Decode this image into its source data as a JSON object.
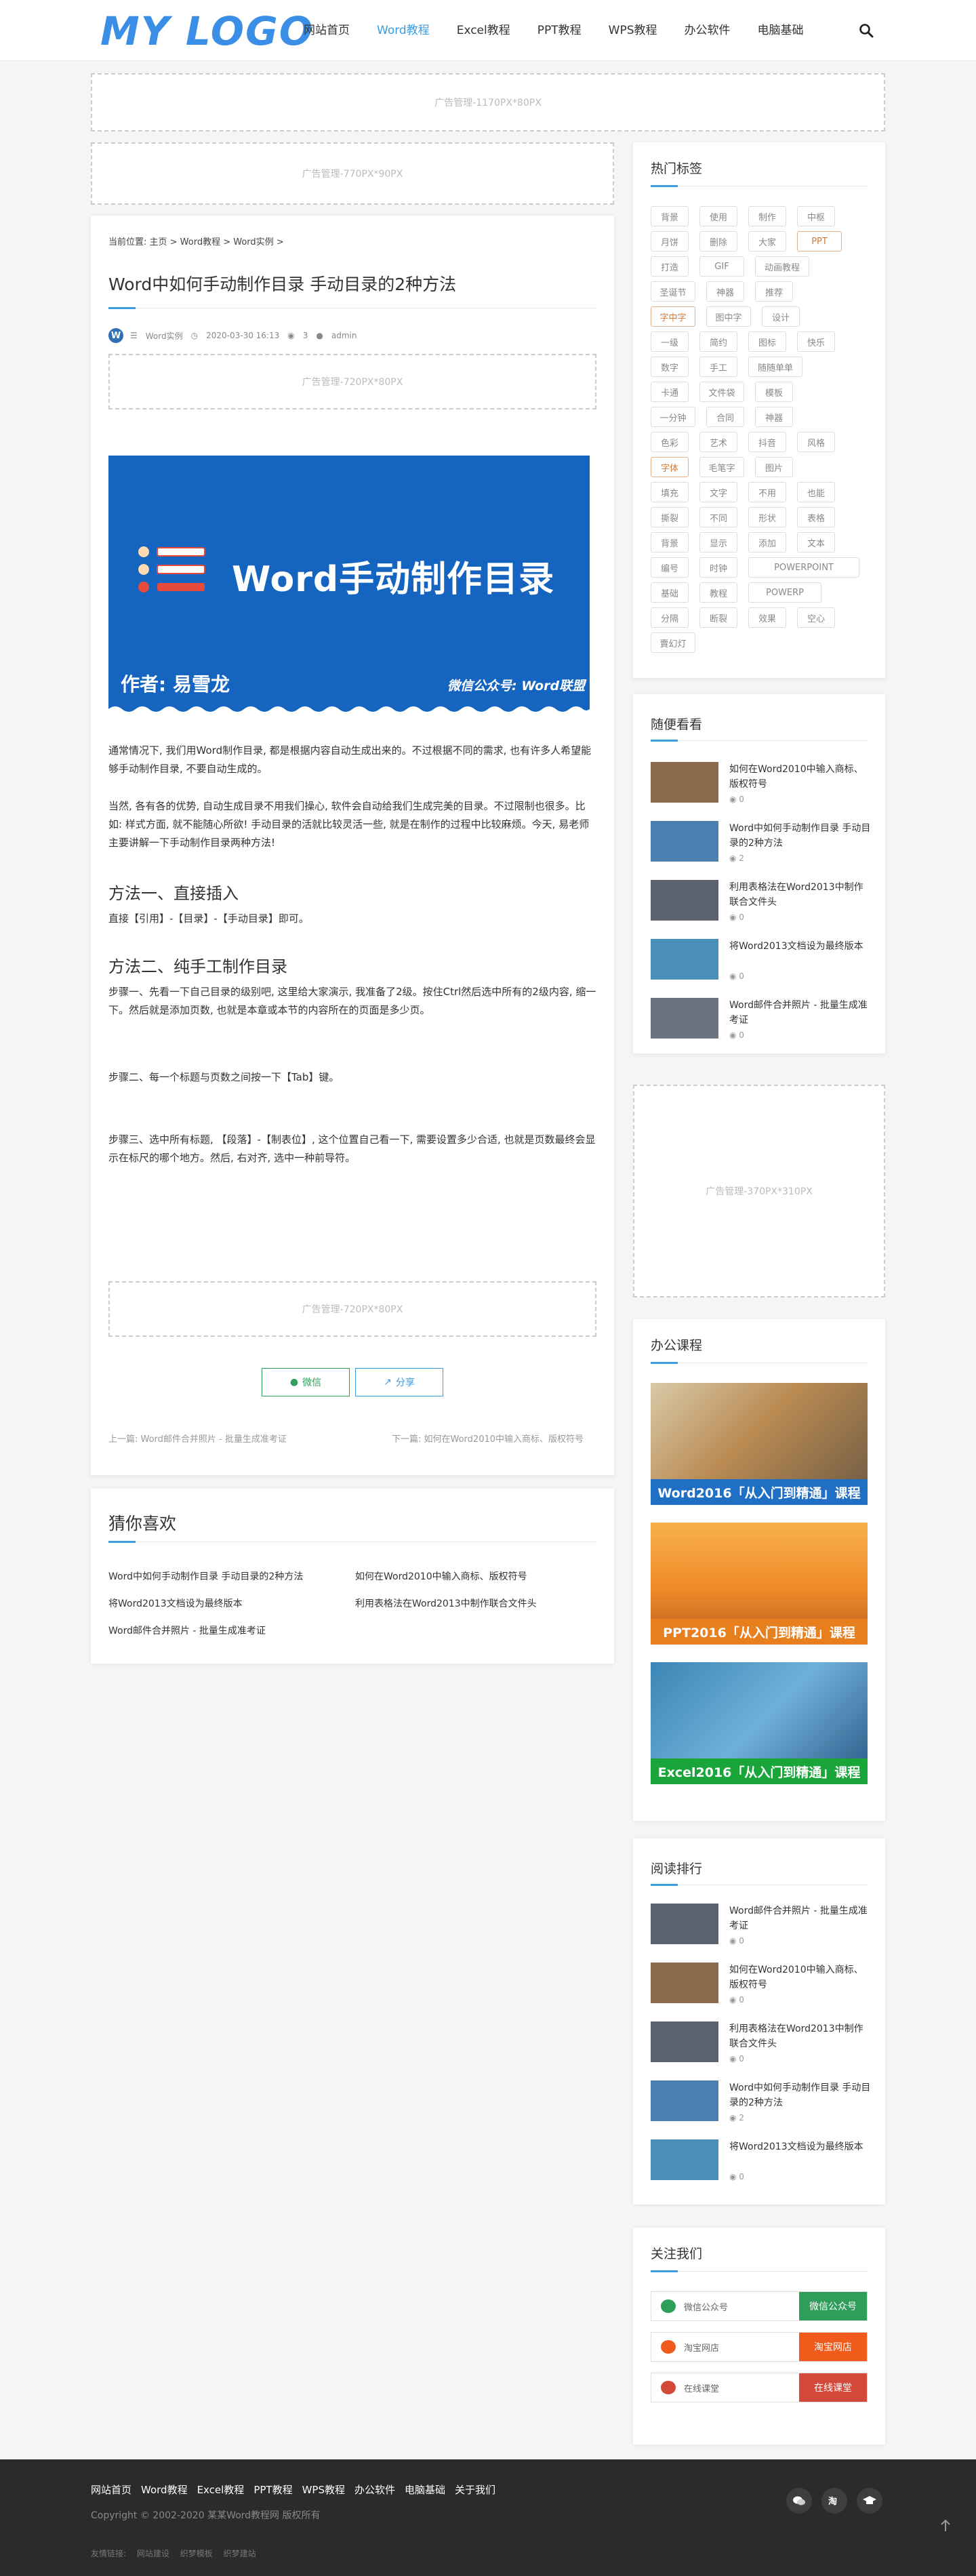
{
  "header": {
    "logo": "MY LOGO",
    "nav": [
      "网站首页",
      "Word教程",
      "Excel教程",
      "PPT教程",
      "WPS教程",
      "办公软件",
      "电脑基础"
    ],
    "active_index": 1
  },
  "ads": {
    "top": "广告管理-1170PX*80PX",
    "main_top": "广告管理-770PX*90PX",
    "article_top": "广告管理-720PX*80PX",
    "article_bottom": "广告管理-720PX*80PX",
    "sidebar": "广告管理-370PX*310PX"
  },
  "article": {
    "breadcrumb": "当前位置: 主页 > Word教程 > Word实例 >",
    "title": "Word中如何手动制作目录 手动目录的2种方法",
    "meta": {
      "category": "Word实例",
      "date": "2020-03-30 16:13",
      "views": "3",
      "author": "admin"
    },
    "banner": {
      "title": "Word手动制作目录",
      "author": "作者: 易雪龙",
      "wechat": "微信公众号: Word联盟"
    },
    "paragraphs": [
      "通常情况下, 我们用Word制作目录, 都是根据内容自动生成出来的。不过根据不同的需求, 也有许多人希望能够手动制作目录, 不要自动生成的。",
      "当然, 各有各的优势, 自动生成目录不用我们操心, 软件会自动给我们生成完美的目录。不过限制也很多。比如: 样式方面, 就不能随心所欲! 手动目录的活就比较灵活一些, 就是在制作的过程中比较麻烦。今天, 易老师主要讲解一下手动制作目录两种方法!"
    ],
    "method1_title": "方法一、直接插入",
    "method1_text": "直接【引用】-【目录】-【手动目录】即可。",
    "method2_title": "方法二、纯手工制作目录",
    "step1": "步骤一、先看一下自己目录的级别吧, 这里给大家演示, 我准备了2级。按住Ctrl然后选中所有的2级内容, 缩一下。然后就是添加页数, 也就是本章或本节的内容所在的页面是多少页。",
    "step2": "步骤二、每一个标题与页数之间按一下【Tab】键。",
    "step3": "步骤三、选中所有标题, 【段落】-【制表位】, 这个位置自己看一下, 需要设置多少合适, 也就是页数最终会显示在标尺的哪个地方。然后, 右对齐, 选中一种前导符。",
    "share": {
      "wechat": "微信",
      "share": "分享"
    },
    "prev": "上一篇: Word邮件合并照片 - 批量生成准考证",
    "next": "下一篇: 如何在Word2010中输入商标、版权符号"
  },
  "guess": {
    "title": "猜你喜欢",
    "items": [
      "Word中如何手动制作目录 手动目录的2种方法",
      "如何在Word2010中输入商标、版权符号",
      "将Word2013文档设为最终版本",
      "利用表格法在Word2013中制作联合文件头",
      "Word邮件合并照片 - 批量生成准考证"
    ]
  },
  "sidebar": {
    "tags_title": "热门标签",
    "tags": [
      [
        "背景",
        "使用",
        "制作",
        "中枢"
      ],
      [
        "月饼",
        "删除",
        "大家",
        "PPT"
      ],
      [
        "打造",
        "GIF",
        "动画教程"
      ],
      [
        "圣诞节",
        "神器",
        "推荐"
      ],
      [
        "字中字",
        "图中字",
        "设计"
      ],
      [
        "一级",
        "简约",
        "图标",
        "快乐"
      ],
      [
        "数字",
        "手工",
        "随随单单"
      ],
      [
        "卡通",
        "文件袋",
        "模板"
      ],
      [
        "一分钟",
        "合同",
        "神器"
      ],
      [
        "色彩",
        "艺术",
        "抖音",
        "风格"
      ],
      [
        "字体",
        "毛笔字",
        "图片"
      ],
      [
        "填充",
        "文字",
        "不用",
        "也能"
      ],
      [
        "撕裂",
        "不同",
        "形状",
        "表格"
      ],
      [
        "背景",
        "显示",
        "添加",
        "文本"
      ],
      [
        "编号",
        "时钟",
        "POWERPOINT"
      ],
      [
        "基础",
        "教程",
        "POWERP"
      ],
      [
        "分隔",
        "断裂",
        "效果",
        "空心"
      ],
      [
        "賣幻灯"
      ]
    ],
    "random_title": "随便看看",
    "random": [
      {
        "title": "如何在Word2010中输入商标、版权符号",
        "views": "0"
      },
      {
        "title": "Word中如何手动制作目录 手动目录的2种方法",
        "views": "2"
      },
      {
        "title": "利用表格法在Word2013中制作联合文件头",
        "views": "0"
      },
      {
        "title": "将Word2013文档设为最终版本",
        "views": "0"
      },
      {
        "title": "Word邮件合并照片 - 批量生成准考证",
        "views": "0"
      }
    ],
    "courses_title": "办公课程",
    "courses": [
      {
        "label": "Word2016「从入门到精通」课程",
        "color": "#1f6fc4"
      },
      {
        "label": "PPT2016「从入门到精通」课程",
        "color": "#e87f1f"
      },
      {
        "label": "Excel2016「从入门到精通」课程",
        "color": "#1aa53a"
      }
    ],
    "ranking_title": "阅读排行",
    "ranking": [
      {
        "title": "Word邮件合并照片 - 批量生成准考证",
        "views": "0"
      },
      {
        "title": "如何在Word2010中输入商标、版权符号",
        "views": "0"
      },
      {
        "title": "利用表格法在Word2013中制作联合文件头",
        "views": "0"
      },
      {
        "title": "Word中如何手动制作目录 手动目录的2种方法",
        "views": "2"
      },
      {
        "title": "将Word2013文档设为最终版本",
        "views": "0"
      }
    ],
    "follow_title": "关注我们",
    "follow": [
      {
        "text": "微信公众号",
        "button": "微信公众号",
        "color": "#2f9e5a",
        "icon": "wechat-icon"
      },
      {
        "text": "淘宝网店",
        "button": "淘宝网店",
        "color": "#f05a1a",
        "icon": "taobao-icon"
      },
      {
        "text": "在线课堂",
        "button": "在线课堂",
        "color": "#d44a3a",
        "icon": "graduation-cap-icon"
      }
    ]
  },
  "footer": {
    "nav": [
      "网站首页",
      "Word教程",
      "Excel教程",
      "PPT教程",
      "WPS教程",
      "办公软件",
      "电脑基础",
      "关于我们"
    ],
    "copyright": "Copyright © 2002-2020 某某Word教程网 版权所有",
    "links_label": "友情链接:",
    "links": [
      "网站建设",
      "织梦模板",
      "织梦建站"
    ]
  }
}
